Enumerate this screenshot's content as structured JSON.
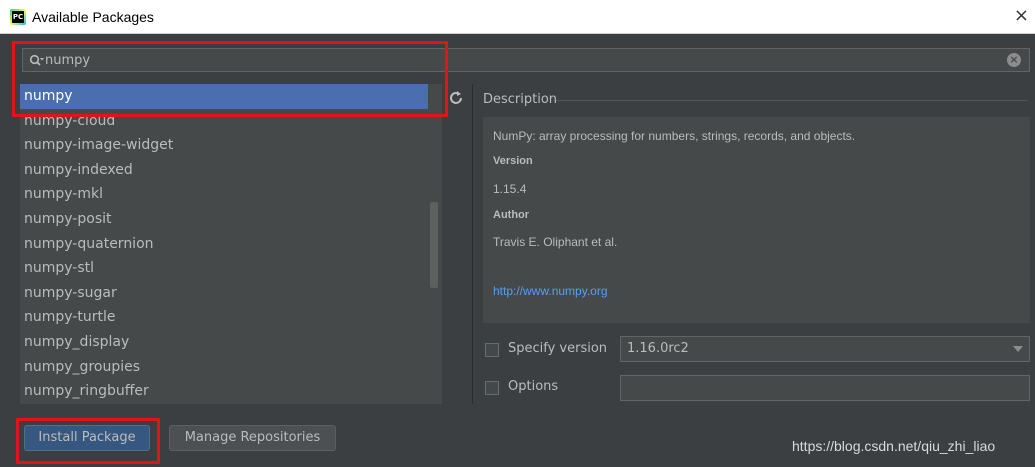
{
  "window": {
    "title": "Available Packages",
    "close_glyph": "×"
  },
  "search": {
    "value": "numpy",
    "placeholder": ""
  },
  "packages": [
    "numpy",
    "numpy-cloud",
    "numpy-image-widget",
    "numpy-indexed",
    "numpy-mkl",
    "numpy-posit",
    "numpy-quaternion",
    "numpy-stl",
    "numpy-sugar",
    "numpy-turtle",
    "numpy_display",
    "numpy_groupies",
    "numpy_ringbuffer"
  ],
  "selected_package": "numpy",
  "description": {
    "section_label": "Description",
    "text": "NumPy: array processing for numbers, strings, records, and objects.",
    "version_label": "Version",
    "version": "1.15.4",
    "author_label": "Author",
    "author": "Travis E. Oliphant et al.",
    "link": "http://www.numpy.org"
  },
  "specify_version": {
    "label": "Specify version",
    "checked": false,
    "value": "1.16.0rc2"
  },
  "options": {
    "label": "Options",
    "checked": false,
    "value": ""
  },
  "buttons": {
    "install": "Install Package",
    "manage": "Manage Repositories"
  },
  "watermark": "https://blog.csdn.net/qiu_zhi_liao",
  "colors": {
    "selection": "#4b6eaf",
    "highlight": "#e0141b",
    "link": "#589df6"
  },
  "icons": [
    "app-icon",
    "search-icon",
    "clear-icon",
    "refresh-icon",
    "chevron-down-icon"
  ]
}
